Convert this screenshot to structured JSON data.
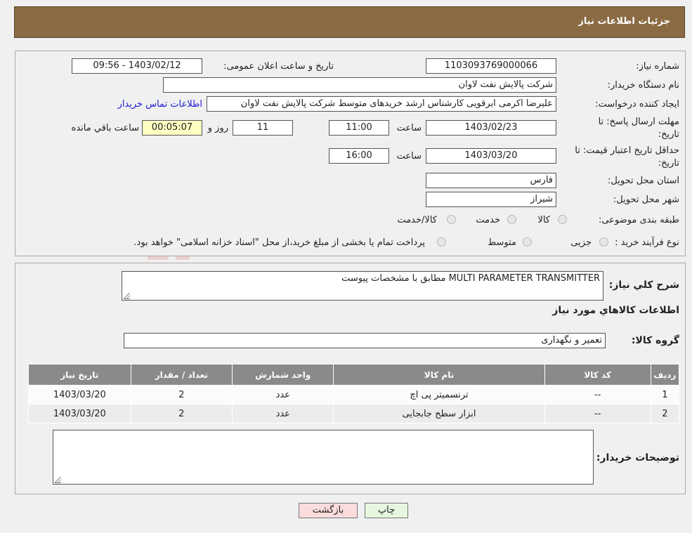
{
  "header": {
    "title": "جزئیات اطلاعات نیاز"
  },
  "form": {
    "need_number_label": "شماره نیاز:",
    "need_number": "1103093769000066",
    "announce_label": "تاریخ و ساعت اعلان عمومی:",
    "announce_value": "1403/02/12 - 09:56",
    "buyer_org_label": "نام دستگاه خریدار:",
    "buyer_org": "شرکت پالایش نفت لاوان",
    "creator_label": "ایجاد کننده درخواست:",
    "creator": "علیرضا اکرمی ابرقویی کارشناس ارشد خریدهای متوسط شرکت پالایش نفت لاوان",
    "contact_link": "اطلاعات تماس خریدار",
    "deadline_label_1": "مهلت ارسال پاسخ: تا",
    "deadline_label_2": "تاریخ:",
    "deadline_date": "1403/02/23",
    "time_label": "ساعت",
    "deadline_time": "11:00",
    "days_value": "11",
    "days_label": "روز و",
    "remaining_time": "00:05:07",
    "remaining_label": "ساعت باقي مانده",
    "validity_label_1": "حداقل تاریخ اعتبار قیمت: تا",
    "validity_label_2": "تاریخ:",
    "validity_date": "1403/03/20",
    "validity_time_label": "ساعت",
    "validity_time": "16:00",
    "province_label": "استان محل تحویل:",
    "province": "فارس",
    "city_label": "شهر محل تحویل:",
    "city": "شیراز",
    "category_label": "طبقه بندی موضوعی:",
    "category_options": [
      "کالا",
      "خدمت",
      "کالا/خدمت"
    ],
    "process_label": "نوع فرآیند خرید :",
    "process_options": [
      "جزیی",
      "متوسط"
    ],
    "process_note": "پرداخت تمام یا بخشی از مبلغ خرید،از محل \"اسناد خزانه اسلامی\" خواهد بود."
  },
  "description": {
    "label": "شرح كلي نياز:",
    "value": "MULTI PARAMETER TRANSMITTER مطابق با مشخصات پیوست",
    "goods_info_title": "اطلاعات كالاهاي مورد نياز",
    "group_label": "گروه کالا:",
    "group_value": "تعمیر و نگهداری"
  },
  "table": {
    "headers": [
      "ردیف",
      "کد کالا",
      "نام کالا",
      "واحد شمارش",
      "تعداد / مقدار",
      "تاریخ نیاز"
    ],
    "rows": [
      [
        "1",
        "--",
        "ترنسمیتر پی اچ",
        "عدد",
        "2",
        "1403/03/20"
      ],
      [
        "2",
        "--",
        "ابزار سطح جابجایی",
        "عدد",
        "2",
        "1403/03/20"
      ]
    ]
  },
  "buyer_notes": {
    "label": "توضیحات خریدار:",
    "value": ""
  },
  "buttons": {
    "print": "چاپ",
    "back": "بازگشت"
  },
  "colors": {
    "header": "#8b6b43",
    "table_header": "#8a8a8a",
    "back_button": "#fbdcdc",
    "print_button": "#e6f7e0"
  }
}
